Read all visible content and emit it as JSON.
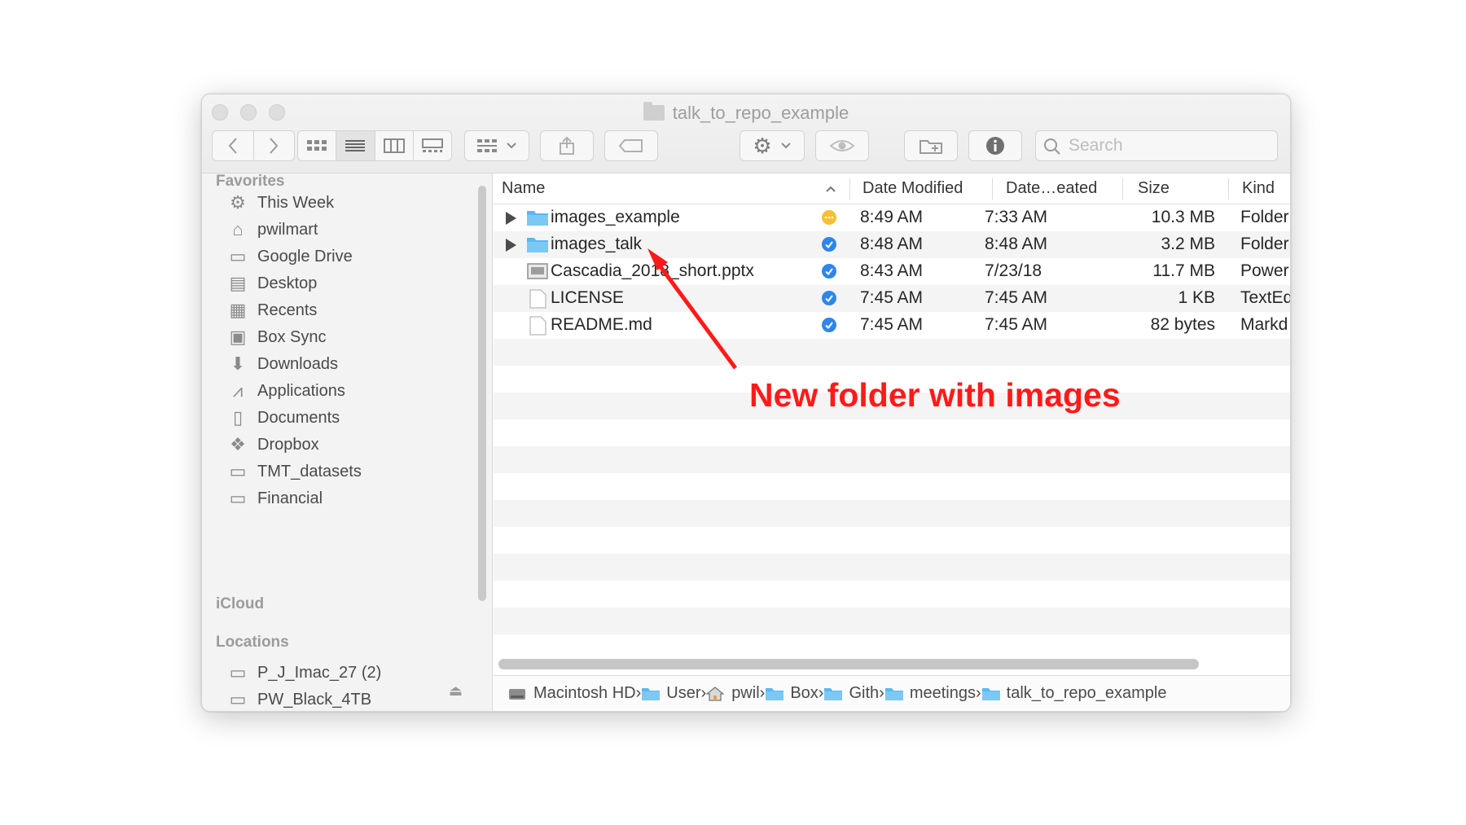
{
  "window": {
    "title": "talk_to_repo_example"
  },
  "toolbar": {
    "search_placeholder": "Search"
  },
  "sidebar": {
    "favorites_heading": "Favorites",
    "favorites": [
      {
        "label": "This Week",
        "icon": "gear-icon"
      },
      {
        "label": "pwilmart",
        "icon": "home-icon"
      },
      {
        "label": "Google Drive",
        "icon": "folder-icon"
      },
      {
        "label": "Desktop",
        "icon": "desktop-icon"
      },
      {
        "label": "Recents",
        "icon": "recents-icon"
      },
      {
        "label": "Box Sync",
        "icon": "box-icon"
      },
      {
        "label": "Downloads",
        "icon": "download-icon"
      },
      {
        "label": "Applications",
        "icon": "applications-icon"
      },
      {
        "label": "Documents",
        "icon": "document-icon"
      },
      {
        "label": "Dropbox",
        "icon": "dropbox-icon"
      },
      {
        "label": "TMT_datasets",
        "icon": "folder-icon"
      },
      {
        "label": "Financial",
        "icon": "folder-icon"
      }
    ],
    "icloud_heading": "iCloud",
    "locations_heading": "Locations",
    "locations": [
      {
        "label": "P_J_Imac_27 (2)",
        "icon": "computer-icon"
      },
      {
        "label": "PW_Black_4TB",
        "icon": "drive-icon"
      }
    ]
  },
  "columns": {
    "name": "Name",
    "date_modified": "Date Modified",
    "date_created": "Date…eated",
    "size": "Size",
    "kind": "Kind"
  },
  "files": [
    {
      "name": "images_example",
      "modified": "8:49 AM",
      "created": "7:33 AM",
      "size": "10.3 MB",
      "kind": "Folder",
      "status_color": "#f5c033"
    },
    {
      "name": "images_talk",
      "modified": "8:48 AM",
      "created": "8:48 AM",
      "size": "3.2 MB",
      "kind": "Folder",
      "status_color": "#2f86e8"
    },
    {
      "name": "Cascadia_2018_short.pptx",
      "modified": "8:43 AM",
      "created": "7/23/18",
      "size": "11.7 MB",
      "kind": "Power",
      "status_color": "#2f86e8"
    },
    {
      "name": "LICENSE",
      "modified": "7:45 AM",
      "created": "7:45 AM",
      "size": "1 KB",
      "kind": "TextEd",
      "status_color": "#2f86e8"
    },
    {
      "name": "README.md",
      "modified": "7:45 AM",
      "created": "7:45 AM",
      "size": "82 bytes",
      "kind": "Markd",
      "status_color": "#2f86e8"
    }
  ],
  "pathbar": [
    "Macintosh HD",
    "User",
    "pwil",
    "Box",
    "Gith",
    "meetings",
    "talk_to_repo_example"
  ],
  "annotation": {
    "text": "New folder with images",
    "color": "#ff1a1a"
  }
}
